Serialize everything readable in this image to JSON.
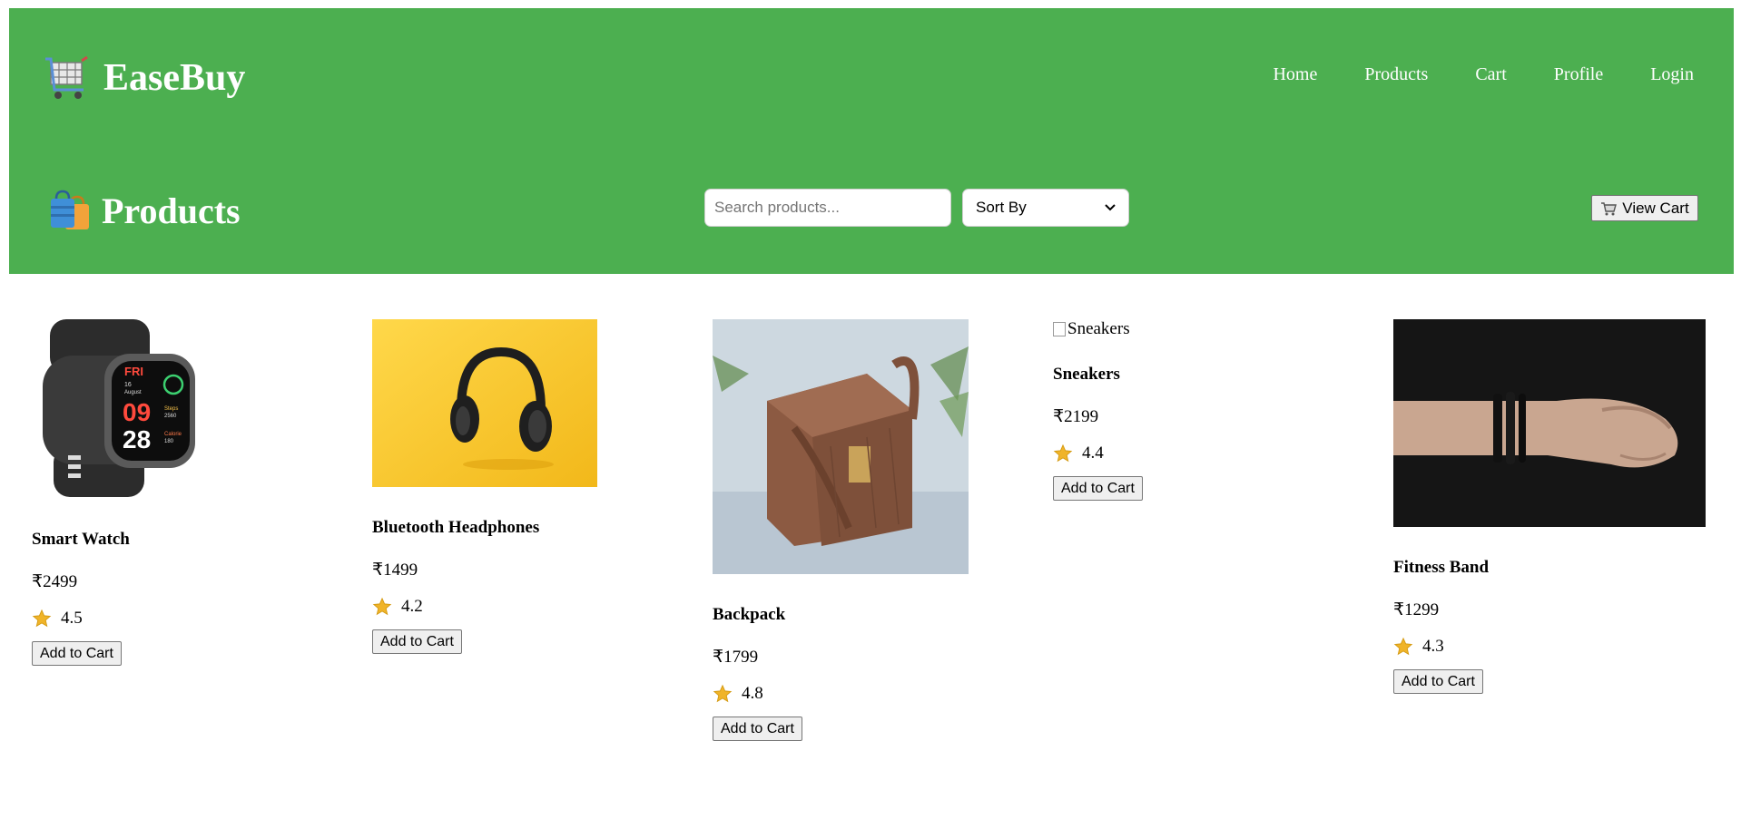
{
  "brand": {
    "title": "EaseBuy",
    "icon": "shopping-cart-icon"
  },
  "nav": {
    "items": [
      "Home",
      "Products",
      "Cart",
      "Profile",
      "Login"
    ]
  },
  "page": {
    "heading": "Products",
    "heading_icon": "shopping-bags-icon"
  },
  "search": {
    "placeholder": "Search products..."
  },
  "sort": {
    "selected": "Sort By"
  },
  "view_cart": {
    "label": "View Cart",
    "icon": "cart-icon"
  },
  "colors": {
    "header_bg": "#4caf50",
    "star": "#f0b429"
  },
  "products": [
    {
      "name": "Smart Watch",
      "price": "₹2499",
      "rating": "4.5",
      "button": "Add to Cart",
      "image": "smart-watch-image"
    },
    {
      "name": "Bluetooth Headphones",
      "price": "₹1499",
      "rating": "4.2",
      "button": "Add to Cart",
      "image": "headphones-image"
    },
    {
      "name": "Backpack",
      "price": "₹1799",
      "rating": "4.8",
      "button": "Add to Cart",
      "image": "backpack-image"
    },
    {
      "name": "Sneakers",
      "price": "₹2199",
      "rating": "4.4",
      "button": "Add to Cart",
      "image_alt": "Sneakers"
    },
    {
      "name": "Fitness Band",
      "price": "₹1299",
      "rating": "4.3",
      "button": "Add to Cart",
      "image": "fitness-band-image"
    }
  ]
}
